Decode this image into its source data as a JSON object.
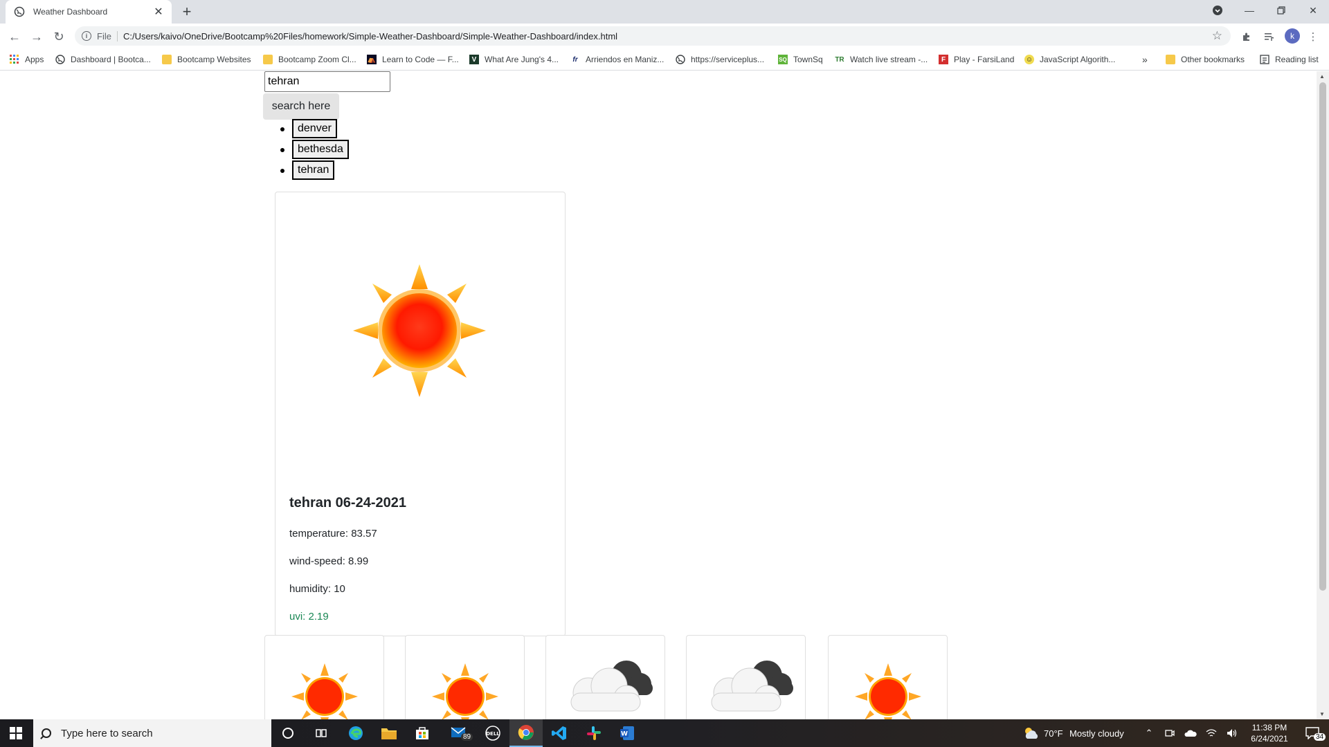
{
  "browser": {
    "tab_title": "Weather Dashboard",
    "new_tab_symbol": "+",
    "omnibox_scheme": "File",
    "url": "C:/Users/kaivo/OneDrive/Bootcamp%20Files/homework/Simple-Weather-Dashboard/Simple-Weather-Dashboard/index.html",
    "profile_initial": "k",
    "bookmarks": [
      {
        "label": "Apps",
        "icon": "apps-grid-icon"
      },
      {
        "label": "Dashboard | Bootca...",
        "icon": "globe-icon"
      },
      {
        "label": "Bootcamp Websites",
        "icon": "folder-icon"
      },
      {
        "label": "Bootcamp Zoom Cl...",
        "icon": "folder-icon"
      },
      {
        "label": "Learn to Code — F...",
        "icon": "fcc-icon"
      },
      {
        "label": "What Are Jung's 4...",
        "icon": "site-icon"
      },
      {
        "label": "Arriendos en Maniz...",
        "icon": "fr-icon"
      },
      {
        "label": "https://serviceplus...",
        "icon": "globe-icon"
      },
      {
        "label": "TownSq",
        "icon": "townsq-icon"
      },
      {
        "label": "Watch live stream -...",
        "icon": "tr-icon"
      },
      {
        "label": "Play - FarsiLand",
        "icon": "farsiland-icon"
      },
      {
        "label": "JavaScript Algorith...",
        "icon": "js-icon"
      }
    ],
    "overflow_label": "»",
    "other_bookmarks": "Other bookmarks",
    "reading_list": "Reading list"
  },
  "search": {
    "value": "tehran",
    "button_label": "search here"
  },
  "history": [
    "denver",
    "bethesda",
    "tehran"
  ],
  "current": {
    "icon": "sun-icon",
    "title": "tehran 06-24-2021",
    "temperature": "temperature: 83.57",
    "wind": "wind-speed: 8.99",
    "humidity": "humidity: 10",
    "uvi": "uvi: 2.19",
    "uvi_color": "#198754"
  },
  "forecast": [
    {
      "icon": "sun-icon"
    },
    {
      "icon": "sun-icon"
    },
    {
      "icon": "cloud-icon"
    },
    {
      "icon": "cloud-icon"
    },
    {
      "icon": "sun-icon"
    }
  ],
  "taskbar": {
    "search_placeholder": "Type here to search",
    "mail_badge": "89",
    "weather_temp": "70°F",
    "weather_text": "Mostly cloudy",
    "time": "11:38 PM",
    "date": "6/24/2021",
    "notification_count": "34"
  }
}
